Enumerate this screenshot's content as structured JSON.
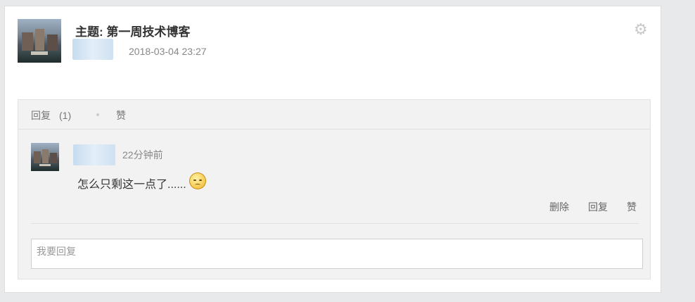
{
  "post": {
    "title": "主题: 第一周技术博客",
    "timestamp": "2018-03-04 23:27"
  },
  "reply_bar": {
    "reply_label": "回复",
    "reply_count": "(1)",
    "like_label": "赞"
  },
  "comments": [
    {
      "time": "22分钟前",
      "text": "怎么只剩这一点了......",
      "emoji": "worried-face-icon",
      "actions": {
        "delete": "删除",
        "reply": "回复",
        "like": "赞"
      }
    }
  ],
  "reply_input": {
    "placeholder": "我要回复"
  },
  "icons": {
    "settings": "gear-icon"
  },
  "colors": {
    "background": "#e8e9eb",
    "card": "#ffffff",
    "reply_area": "#f2f2f2",
    "text": "#333333",
    "muted": "#888888"
  }
}
